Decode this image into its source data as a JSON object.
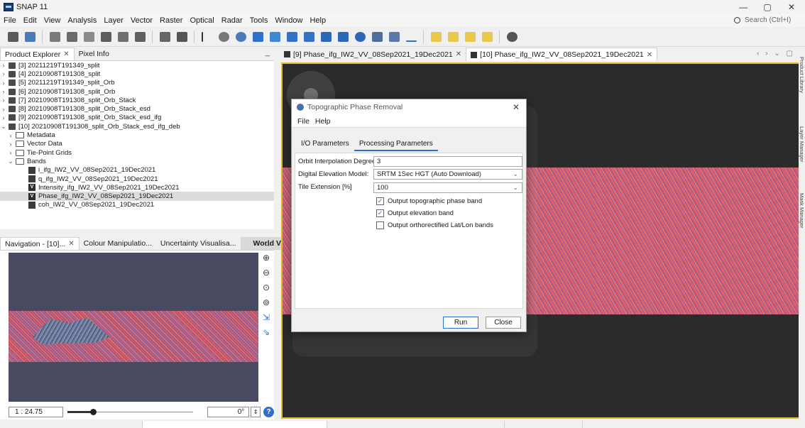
{
  "window": {
    "title": "SNAP 11",
    "controls": [
      "—",
      "▢",
      "✕"
    ]
  },
  "menu": [
    "File",
    "Edit",
    "View",
    "Analysis",
    "Layer",
    "Vector",
    "Raster",
    "Optical",
    "Radar",
    "Tools",
    "Window",
    "Help"
  ],
  "search": {
    "placeholder": "Search (Ctrl+I)"
  },
  "left_tabs": [
    {
      "label": "Product Explorer",
      "close": "✕"
    },
    {
      "label": "Pixel Info"
    }
  ],
  "tree": [
    {
      "arrow": "›",
      "label": "[3] 20211219T191349_split"
    },
    {
      "arrow": "›",
      "label": "[4] 20210908T191308_split"
    },
    {
      "arrow": "›",
      "label": "[5] 20211219T191349_split_Orb"
    },
    {
      "arrow": "›",
      "label": "[6] 20210908T191308_split_Orb"
    },
    {
      "arrow": "›",
      "label": "[7] 20210908T191308_split_Orb_Stack"
    },
    {
      "arrow": "›",
      "label": "[8] 20210908T191308_split_Orb_Stack_esd"
    },
    {
      "arrow": "›",
      "label": "[9] 20210908T191308_split_Orb_Stack_esd_ifg"
    },
    {
      "arrow": "⌄",
      "label": "[10] 20210908T191308_split_Orb_Stack_esd_ifg_deb"
    }
  ],
  "tree_children": [
    {
      "arrow": "›",
      "label": "Metadata"
    },
    {
      "arrow": "›",
      "label": "Vector Data"
    },
    {
      "arrow": "›",
      "label": "Tie-Point Grids"
    },
    {
      "arrow": "⌄",
      "label": "Bands"
    }
  ],
  "bands": [
    {
      "label": "i_ifg_IW2_VV_08Sep2021_19Dec2021",
      "virtual": false
    },
    {
      "label": "q_ifg_IW2_VV_08Sep2021_19Dec2021",
      "virtual": false
    },
    {
      "label": "Intensity_ifg_IW2_VV_08Sep2021_19Dec2021",
      "virtual": true
    },
    {
      "label": "Phase_ifg_IW2_VV_08Sep2021_19Dec2021",
      "virtual": true,
      "selected": true
    },
    {
      "label": "coh_IW2_VV_08Sep2021_19Dec2021",
      "virtual": false
    }
  ],
  "nav_tabs": [
    {
      "label": "Navigation - [10]...",
      "close": "✕"
    },
    {
      "label": "Colour Manipulatio..."
    },
    {
      "label": "Uncertainty Visualisa..."
    },
    {
      "label": "World View"
    }
  ],
  "nav": {
    "scale": "1 : 24.75",
    "angle": "0°",
    "slider_fraction": 0.2,
    "spin": "⇕",
    "help": "?"
  },
  "image_tabs": [
    {
      "label": "[9] Phase_ifg_IW2_VV_08Sep2021_19Dec2021",
      "close": "✕"
    },
    {
      "label": "[10] Phase_ifg_IW2_VV_08Sep2021_19Dec2021",
      "close": "✕",
      "active": true
    }
  ],
  "tab_controls": "‹ › ⌄ ▢",
  "right_labels": [
    "Product Library",
    "Layer Manager",
    "Mask Manager"
  ],
  "dialog": {
    "title": "Topographic Phase Removal",
    "close": "✕",
    "menu": [
      "File",
      "Help"
    ],
    "tabs": [
      "I/O Parameters",
      "Processing Parameters"
    ],
    "fields": {
      "orbit_label": "Orbit Interpolation Degree:",
      "orbit_value": "3",
      "dem_label": "Digital Elevation Model:",
      "dem_value": "SRTM 1Sec HGT (Auto Download)",
      "tile_label": "Tile Extension [%]",
      "tile_value": "100"
    },
    "checkboxes": [
      {
        "label": "Output topographic phase band",
        "checked": true
      },
      {
        "label": "Output elevation band",
        "checked": true
      },
      {
        "label": "Output orthorectified Lat/Lon bands",
        "checked": false
      }
    ],
    "buttons": {
      "run": "Run",
      "close": "Close"
    }
  },
  "icons": [
    "snap-logo-icon",
    "open-product-icon",
    "save-icon",
    "zoom-in-icon",
    "zoom-out-icon",
    "pan-icon",
    "select-icon"
  ],
  "colors": {
    "accent": "#2f6fce",
    "view_border": "#e2bc2b",
    "phase_red": "#e2616a",
    "phase_purple": "#6a65b5"
  }
}
